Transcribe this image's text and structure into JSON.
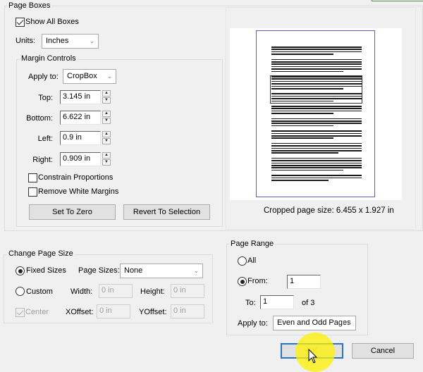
{
  "page_boxes": {
    "title": "Page Boxes",
    "show_all_boxes": {
      "label": "Show All Boxes",
      "checked": true
    },
    "units": {
      "label": "Units:",
      "value": "Inches"
    },
    "margin_controls": {
      "title": "Margin Controls",
      "apply_to": {
        "label": "Apply to:",
        "value": "CropBox"
      },
      "top": {
        "label": "Top:",
        "value": "3.145 in"
      },
      "bottom": {
        "label": "Bottom:",
        "value": "6.622 in"
      },
      "left": {
        "label": "Left:",
        "value": "0.9 in"
      },
      "right": {
        "label": "Right:",
        "value": "0.909 in"
      },
      "constrain_proportions": {
        "label": "Constrain Proportions",
        "checked": false
      },
      "remove_white_margins": {
        "label": "Remove White Margins",
        "checked": false
      },
      "set_to_zero_label": "Set To Zero",
      "revert_to_selection_label": "Revert To Selection"
    }
  },
  "preview": {
    "cropped_page_size": "Cropped page size: 6.455 x 1.927 in"
  },
  "change_page_size": {
    "title": "Change Page Size",
    "fixed_sizes": {
      "label": "Fixed Sizes",
      "selected": true
    },
    "page_sizes": {
      "label": "Page Sizes:",
      "value": "None"
    },
    "custom": {
      "label": "Custom",
      "selected": false
    },
    "width": {
      "label": "Width:",
      "value": "0 in"
    },
    "height": {
      "label": "Height:",
      "value": "0 in"
    },
    "center": {
      "label": "Center",
      "checked": true,
      "disabled": true
    },
    "xoffset": {
      "label": "XOffset:",
      "value": "0 in"
    },
    "yoffset": {
      "label": "YOffset:",
      "value": "0 in"
    }
  },
  "page_range": {
    "title": "Page Range",
    "all": {
      "label": "All",
      "selected": false
    },
    "from": {
      "label": "From:",
      "selected": true,
      "value": "1"
    },
    "to": {
      "label": "To:",
      "value": "1",
      "of_text": "of 3"
    },
    "apply_to": {
      "label": "Apply to:",
      "value": "Even and Odd Pages"
    }
  },
  "footer": {
    "ok_label": "OK",
    "cancel_label": "Cancel"
  },
  "icons": {
    "chevron": "⌄",
    "spin_up": "▲",
    "spin_down": "▼"
  }
}
